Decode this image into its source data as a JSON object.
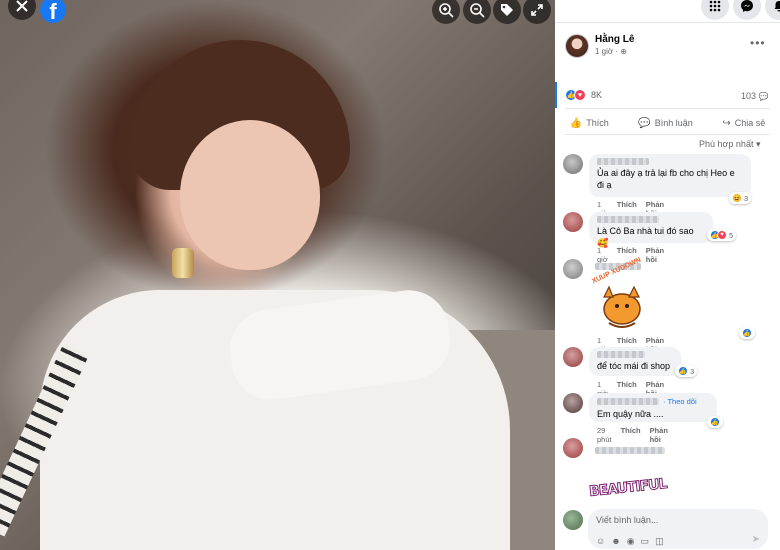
{
  "viewer": {
    "icons": [
      "close-icon",
      "facebook-logo",
      "zoom-in-icon",
      "zoom-out-icon",
      "tag-icon",
      "fullscreen-icon"
    ]
  },
  "topbar": {
    "icons": [
      "menu-grid-icon",
      "messenger-icon",
      "notifications-icon"
    ]
  },
  "post": {
    "author": "Hằng Lê",
    "time": "1 giờ · ⊕",
    "more": "•••",
    "reaction_count": "8K",
    "comment_count": "103"
  },
  "actions": {
    "like": "Thích",
    "comment": "Bình luận",
    "share": "Chia sẻ"
  },
  "sort_label": "Phù hợp nhất ▾",
  "comments": [
    {
      "text": "Ủa ai đây ạ trả lại fb cho chị Heo e đi ạ",
      "time": "1 giờ",
      "like": "Thích",
      "reply": "Phản hồi",
      "reaction_count": "3"
    },
    {
      "text": "Là Cô Ba nhà tui đó sao",
      "emoji": "🥰",
      "time": "1 giờ",
      "like": "Thích",
      "reply": "Phản hồi",
      "reaction_count": "5"
    },
    {
      "sticker_text": "XUUP XUDOWN",
      "time": "1 giờ",
      "like": "Thích",
      "reply": "Phản hồi"
    },
    {
      "text": "để tóc mái đi shop",
      "time": "1 giờ",
      "like": "Thích",
      "reply": "Phản hồi",
      "reaction_count": "3"
    },
    {
      "text": "Em quậy nữa ....",
      "follow": "· Theo dõi",
      "time": "29 phút",
      "like": "Thích",
      "reply": "Phản hồi"
    },
    {
      "sticker_text": "BEAUTIFUL"
    }
  ],
  "composer": {
    "placeholder": "Viết bình luận..."
  },
  "colors": {
    "facebook_blue": "#1877f2",
    "love_red": "#f33e58",
    "haha_yellow": "#f7b125"
  }
}
